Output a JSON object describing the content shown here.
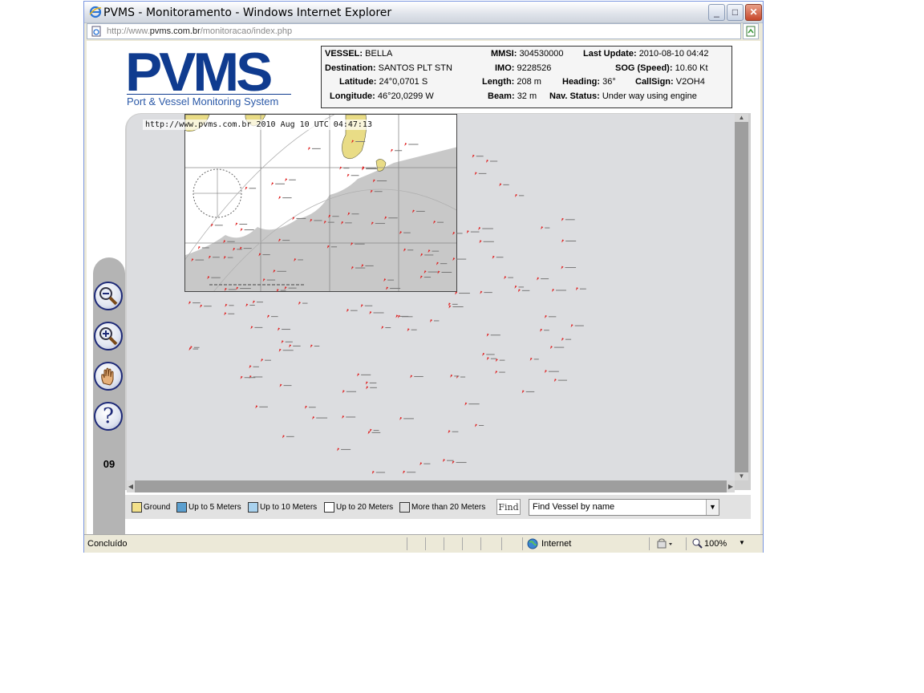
{
  "window": {
    "title": "PVMS - Monitoramento - Windows Internet Explorer",
    "controls": {
      "minimize": "_",
      "maximize": "□",
      "close": "✕"
    }
  },
  "address_bar": {
    "url_prefix": "http://www.",
    "url_domain": "pvms.com.br",
    "url_path": "/monitoracao/index.php"
  },
  "logo": {
    "title": "PVMS",
    "subtitle": "Port & Vessel Monitoring System"
  },
  "vessel_info": {
    "vessel_label": "VESSEL:",
    "vessel": "BELLA",
    "mmsi_label": "MMSI:",
    "mmsi": "304530000",
    "last_update_label": "Last Update:",
    "last_update": "2010-08-10 04:42",
    "destination_label": "Destination:",
    "destination": "SANTOS PLT STN",
    "imo_label": "IMO:",
    "imo": "9228526",
    "sog_label": "SOG (Speed):",
    "sog": "10.60 Kt",
    "latitude_label": "Latitude:",
    "latitude": "24°0,0701 S",
    "length_label": "Length:",
    "length": "208 m",
    "heading_label": "Heading:",
    "heading": "36°",
    "callsign_label": "CallSign:",
    "callsign": "V2OH4",
    "longitude_label": "Longitude:",
    "longitude": "46°20,0299 W",
    "beam_label": "Beam:",
    "beam": "32 m",
    "nav_status_label": "Nav. Status:",
    "nav_status": "Under way using engine"
  },
  "map": {
    "timestamp": "http://www.pvms.com.br 2010 Aug 10 UTC 04:47:13",
    "zoom_level_label": "09"
  },
  "tools": [
    {
      "name": "zoom-out",
      "icon": "zoom-out-icon"
    },
    {
      "name": "zoom-in",
      "icon": "zoom-in-icon"
    },
    {
      "name": "pan",
      "icon": "hand-icon"
    },
    {
      "name": "help",
      "icon": "help-icon",
      "glyph": "?"
    }
  ],
  "legend": {
    "items": [
      {
        "label": "Ground",
        "color": "#f2e08a"
      },
      {
        "label": "Up to 5 Meters",
        "color": "#5b9fcf"
      },
      {
        "label": "Up to 10 Meters",
        "color": "#a9d2ee"
      },
      {
        "label": "Up to 20 Meters",
        "color": "#ffffff"
      },
      {
        "label": "More than 20 Meters",
        "color": "#e0e0e0"
      }
    ],
    "find_button": "Find",
    "find_select_value": "Find Vessel by name"
  },
  "status_bar": {
    "status": "Concluído",
    "zone": "Internet",
    "zoom": "100%"
  },
  "colors": {
    "brand_blue": "#0f3b8f",
    "vessel_marker": "#e02020",
    "sea": "#dcdde0",
    "land": "#bfbfbf"
  }
}
